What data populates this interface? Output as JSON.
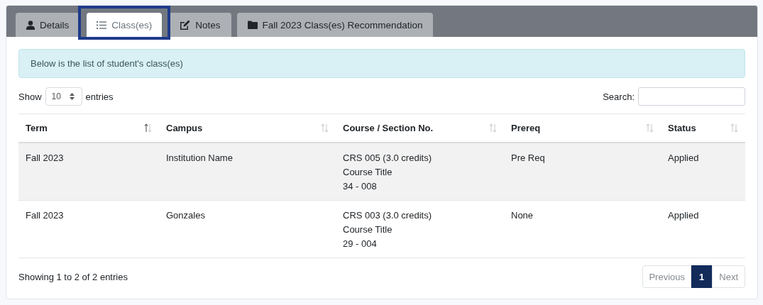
{
  "tabs": [
    {
      "label": "Details",
      "selected": false,
      "highlighted": false
    },
    {
      "label": "Class(es)",
      "selected": true,
      "highlighted": true
    },
    {
      "label": "Notes",
      "selected": false,
      "highlighted": false
    },
    {
      "label": "Fall 2023 Class(es) Recommendation",
      "selected": false,
      "highlighted": false
    }
  ],
  "info_message": "Below is the list of student's class(es)",
  "length_menu": {
    "prefix": "Show",
    "value": "10",
    "suffix": "entries"
  },
  "search": {
    "label": "Search:"
  },
  "table": {
    "columns": [
      {
        "label": "Term",
        "sorted": true
      },
      {
        "label": "Campus",
        "sorted": false
      },
      {
        "label": "Course / Section No.",
        "sorted": false
      },
      {
        "label": "Prereq",
        "sorted": false
      },
      {
        "label": "Status",
        "sorted": false
      }
    ],
    "rows": [
      {
        "cells": [
          [
            "Fall 2023"
          ],
          [
            "Institution Name"
          ],
          [
            "CRS 005 (3.0 credits)",
            "Course Title",
            "34 - 008"
          ],
          [
            "Pre Req"
          ],
          [
            "Applied"
          ]
        ]
      },
      {
        "cells": [
          [
            "Fall 2023"
          ],
          [
            "Gonzales"
          ],
          [
            "CRS 003 (3.0 credits)",
            "Course Title",
            "29 - 004"
          ],
          [
            "None"
          ],
          [
            "Applied"
          ]
        ]
      }
    ]
  },
  "table_info": "Showing 1 to 2 of 2 entries",
  "pagination": [
    {
      "label": "Previous",
      "selected": false
    },
    {
      "label": "1",
      "selected": true
    },
    {
      "label": "Next",
      "selected": false
    }
  ]
}
